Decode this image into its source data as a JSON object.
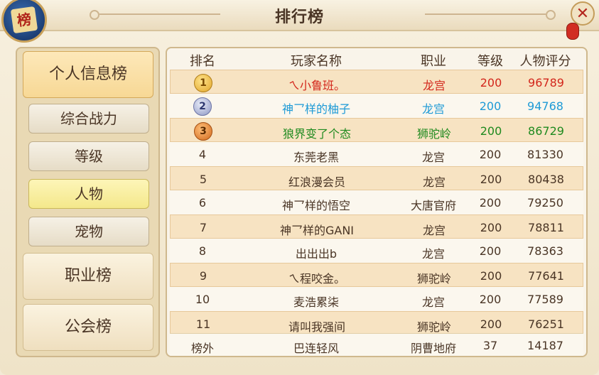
{
  "window": {
    "title": "排行榜",
    "logo_glyph": "榜",
    "close_glyph": "✕"
  },
  "sidebar": {
    "personal_tab": "个人信息榜",
    "sub_tabs": [
      "综合战力",
      "等级",
      "人物",
      "宠物"
    ],
    "selected_sub_tab": "人物",
    "job_tab": "职业榜",
    "guild_tab": "公会榜"
  },
  "table": {
    "headers": {
      "rank": "排名",
      "name": "玩家名称",
      "job": "职业",
      "level": "等级",
      "score": "人物评分"
    },
    "rows": [
      {
        "rank": "1",
        "name": "ㄟ小鲁班。",
        "job": "龙宫",
        "level": "200",
        "score": "96789",
        "color": "#d3261b"
      },
      {
        "rank": "2",
        "name": "神乛样的柚子",
        "job": "龙宫",
        "level": "200",
        "score": "94768",
        "color": "#1e9ad6"
      },
      {
        "rank": "3",
        "name": "狼界变了个态",
        "job": "狮驼岭",
        "level": "200",
        "score": "86729",
        "color": "#1f8a1f"
      },
      {
        "rank": "4",
        "name": "东莞老黑",
        "job": "龙宫",
        "level": "200",
        "score": "81330"
      },
      {
        "rank": "5",
        "name": "红浪漫会员",
        "job": "龙宫",
        "level": "200",
        "score": "80438"
      },
      {
        "rank": "6",
        "name": "神乛样的悟空",
        "job": "大唐官府",
        "level": "200",
        "score": "79250"
      },
      {
        "rank": "7",
        "name": "神乛样的GANI",
        "job": "龙宫",
        "level": "200",
        "score": "78811"
      },
      {
        "rank": "8",
        "name": "出出出b",
        "job": "龙宫",
        "level": "200",
        "score": "78363"
      },
      {
        "rank": "9",
        "name": "ㄟ程咬金。",
        "job": "狮驼岭",
        "level": "200",
        "score": "77641"
      },
      {
        "rank": "10",
        "name": "麦浩累柒",
        "job": "龙宫",
        "level": "200",
        "score": "77589"
      },
      {
        "rank": "11",
        "name": "请叫我强间",
        "job": "狮驼岭",
        "level": "200",
        "score": "76251"
      }
    ],
    "my_row": {
      "rank": "榜外",
      "name": "巴连轻风",
      "job": "阴曹地府",
      "level": "37",
      "score": "14187"
    }
  },
  "colors": {
    "gold": "#e0a52a",
    "silver": "#8d96c3",
    "bronze": "#d1681c"
  }
}
